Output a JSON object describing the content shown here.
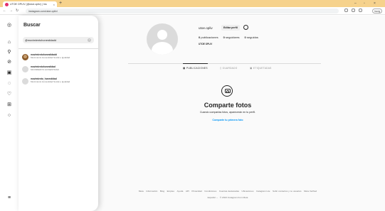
{
  "browser": {
    "tab_title": "UTOE OPLIV (@utoe.opliv) | Ins",
    "tab_close": "×",
    "new_tab": "+",
    "url": "instagram.com/utoe.opliv/",
    "profile_btn": "Incóg",
    "window_controls": [
      "‒",
      "▫",
      "×"
    ]
  },
  "rail": {
    "icons": [
      "instagram-icon",
      "home-icon",
      "search-icon",
      "explore-icon",
      "reels-icon",
      "messages-icon",
      "notifications-icon",
      "create-icon",
      "profile-icon",
      "menu-icon"
    ]
  },
  "search": {
    "heading": "Buscar",
    "query": "@movimientohonestidadd",
    "clear": "×",
    "results": [
      {
        "username": "movimientohonestidadd",
        "name": "Movimiento Honestidad Social e Igualdad",
        "photo": true
      },
      {
        "username": "movimientohonestidad",
        "name": "MOVIMIENTO HONESTIDAD",
        "photo": false
      },
      {
        "username": "movimiento_honestidad",
        "name": "Movimiento Honestidad Social e Igualdad",
        "photo": false
      }
    ]
  },
  "profile": {
    "username": "utoe.opliv",
    "edit_button": "Editar perfil",
    "posts_count": "0",
    "posts_label": "publicaciones",
    "followers_count": "0",
    "followers_label": "seguidores",
    "following_count": "0",
    "following_label": "seguidos",
    "full_name": "UTOE OPLIV"
  },
  "tabs": [
    {
      "label": "PUBLICACIONES",
      "icon": "grid-icon",
      "active": true
    },
    {
      "label": "GUARDADO",
      "icon": "bookmark-icon",
      "active": false
    },
    {
      "label": "ETIQUETADAS",
      "icon": "tag-icon",
      "active": false
    }
  ],
  "empty_state": {
    "title": "Comparte fotos",
    "subtitle": "Cuando compartas fotos, aparecerán en tu perfil.",
    "link": "Comparte tu primera foto"
  },
  "footer": {
    "links": [
      "Meta",
      "Información",
      "Blog",
      "Empleo",
      "Ayuda",
      "API",
      "Privacidad",
      "Condiciones",
      "Cuentas destacadas",
      "Ubicaciones",
      "Instagram Lite",
      "Subir contactos y no usuarios",
      "Meta Verified"
    ],
    "language": "Español ⌄",
    "copyright": "© 2023 Instagram from Meta"
  },
  "colors": {
    "link_blue": "#0095f6",
    "tabstrip": "#f6d28c"
  }
}
